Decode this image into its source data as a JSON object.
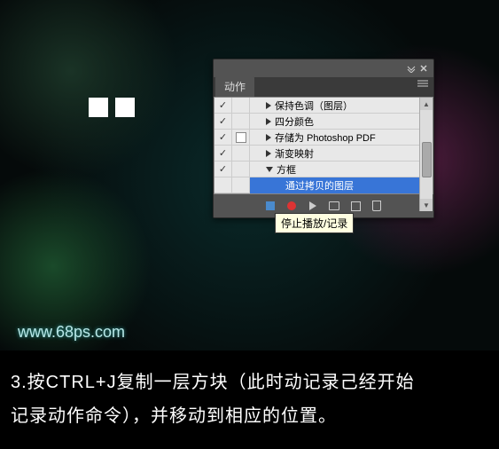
{
  "panel": {
    "tab_label": "动作",
    "rows": [
      {
        "check": "✓",
        "mode": "",
        "arrow": "right",
        "label": "保持色调（图层）",
        "indent": 1
      },
      {
        "check": "✓",
        "mode": "",
        "arrow": "right",
        "label": "四分颜色",
        "indent": 1
      },
      {
        "check": "✓",
        "mode": "box",
        "arrow": "right",
        "label": "存储为 Photoshop PDF",
        "indent": 1
      },
      {
        "check": "✓",
        "mode": "",
        "arrow": "right",
        "label": "渐变映射",
        "indent": 1
      },
      {
        "check": "✓",
        "mode": "",
        "arrow": "down",
        "label": "方框",
        "indent": 1
      },
      {
        "check": "",
        "mode": "",
        "arrow": "",
        "label": "通过拷贝的图层",
        "indent": 2,
        "selected": true
      }
    ]
  },
  "tooltip": {
    "text": "停止播放/记录"
  },
  "watermark": {
    "text": "www.68ps.com"
  },
  "instruction": {
    "line1": "3.按CTRL+J复制一层方块（此时动记录己经开始",
    "line2": "记录动作命令），并移动到相应的位置。"
  }
}
